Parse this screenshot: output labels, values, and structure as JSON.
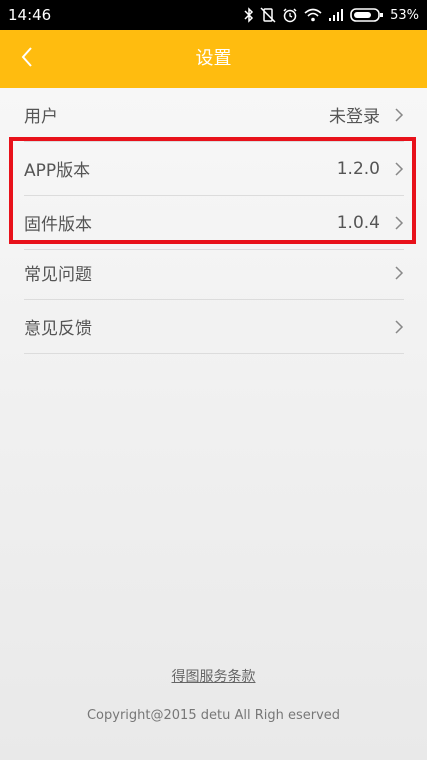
{
  "statusbar": {
    "time": "14:46",
    "battery_text": "53%",
    "icons": [
      "bluetooth-icon",
      "vibrate-off-icon",
      "alarm-icon",
      "wifi-icon",
      "signal-icon",
      "battery-icon"
    ]
  },
  "appbar": {
    "title": "设置",
    "back_icon": "chevron-left-icon",
    "background": "#ffbc0f"
  },
  "settings": {
    "items": [
      {
        "label": "用户",
        "value": "未登录"
      },
      {
        "label": "APP版本",
        "value": "1.2.0"
      },
      {
        "label": "固件版本",
        "value": "1.0.4"
      },
      {
        "label": "常见问题",
        "value": ""
      },
      {
        "label": "意见反馈",
        "value": ""
      }
    ]
  },
  "highlight": {
    "color": "#e8111a"
  },
  "footer": {
    "terms_link": "得图服务条款",
    "copyright": "Copyright@2015 detu All Righ  eserved"
  }
}
